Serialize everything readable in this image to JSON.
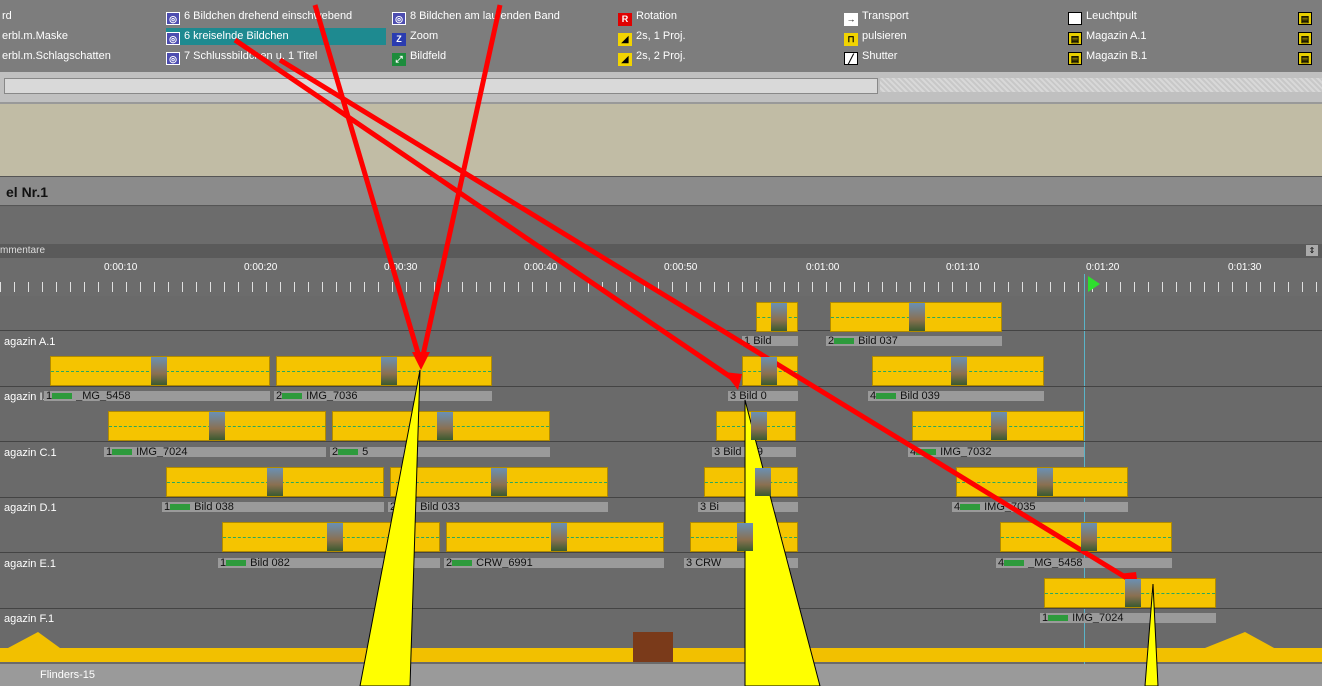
{
  "effects": [
    {
      "label": "rd",
      "icon": "none"
    },
    {
      "label": "erbl.m.Maske",
      "icon": "none"
    },
    {
      "label": "erbl.m.Schlagschatten",
      "icon": "none"
    },
    {
      "label": "6 Bildchen drehend einschwebend",
      "icon": "dual-image-icon"
    },
    {
      "label": "6 kreiselnde Bildchen",
      "icon": "dual-image-icon",
      "selected": true
    },
    {
      "label": "7 Schlussbildchen u. 1 Titel",
      "icon": "dual-image-icon"
    },
    {
      "label": "8 Bildchen am laufenden Band",
      "icon": "dual-image-icon"
    },
    {
      "label": "Zoom",
      "icon": "zoom-icon",
      "glyph": "Z"
    },
    {
      "label": "Bildfeld",
      "icon": "bildfeld-icon"
    },
    {
      "label": "Rotation",
      "icon": "rotation-icon",
      "glyph": "R"
    },
    {
      "label": "2s, 1 Proj.",
      "icon": "fade-icon"
    },
    {
      "label": "2s, 2 Proj.",
      "icon": "fade-icon"
    },
    {
      "label": "Transport",
      "icon": "transport-arrow-icon",
      "glyph": "→"
    },
    {
      "label": "pulsieren",
      "icon": "pulse-icon"
    },
    {
      "label": "Shutter",
      "icon": "shutter-icon"
    },
    {
      "label": "Leuchtpult",
      "icon": "lightbox-icon"
    },
    {
      "label": "Magazin A.1",
      "icon": "magazine-icon"
    },
    {
      "label": "Magazin B.1",
      "icon": "magazine-icon"
    }
  ],
  "show_title": "el Nr.1",
  "comment_row_label": "mmentare",
  "timeline_ticks": [
    "0:00:10",
    "0:00:20",
    "0:00:30",
    "0:00:40",
    "0:00:50",
    "0:01:00",
    "0:01:10",
    "0:01:20",
    "0:01:30"
  ],
  "tracks": [
    {
      "label": "agazin A.1"
    },
    {
      "label": "agazin I.1"
    },
    {
      "label": "agazin C.1"
    },
    {
      "label": "agazin D.1"
    },
    {
      "label": "agazin E.1"
    },
    {
      "label": "agazin F.1"
    }
  ],
  "clips": {
    "a1": {
      "num": "1",
      "name": "Bild"
    },
    "a2": {
      "num": "2",
      "name": "Bild 037"
    },
    "b1": {
      "num": "1",
      "name": "_MG_5458"
    },
    "b2": {
      "num": "2",
      "name": "IMG_7036"
    },
    "b3": {
      "num": "3",
      "name": "Bild 0"
    },
    "b4": {
      "num": "4",
      "name": "Bild 039"
    },
    "c1": {
      "num": "1",
      "name": "IMG_7024"
    },
    "c2": {
      "num": "2",
      "name": "5"
    },
    "c3": {
      "num": "3",
      "name": "Bild 039"
    },
    "c4": {
      "num": "4",
      "name": "IMG_7032"
    },
    "d1": {
      "num": "1",
      "name": "Bild 038"
    },
    "d2": {
      "num": "2",
      "name": "Bild 033"
    },
    "d3": {
      "num": "3",
      "name": "Bi"
    },
    "d4": {
      "num": "4",
      "name": "IMG_7035"
    },
    "e1": {
      "num": "1",
      "name": "Bild 082"
    },
    "e2": {
      "num": "2",
      "name": "CRW_6991"
    },
    "e3": {
      "num": "3",
      "name": "CRW"
    },
    "e4": {
      "num": "4",
      "name": "_MG_5458"
    },
    "f1": {
      "num": "1",
      "name": "IMG_7024"
    }
  },
  "bottom_track_label": "Flinders-15",
  "colors": {
    "clip": "#f5c400",
    "arrow": "#ff0000",
    "callout": "#ffff00",
    "selection": "#1e8a90"
  }
}
